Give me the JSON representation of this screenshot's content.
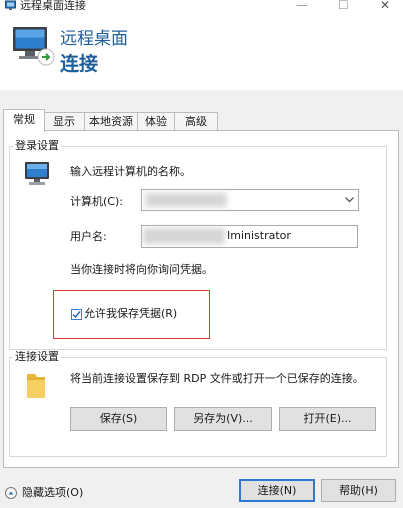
{
  "window": {
    "title": "远程桌面连接",
    "controls": [
      "—",
      "☐",
      "✕"
    ]
  },
  "banner": {
    "line1": "远程桌面",
    "line2": "连接"
  },
  "tabs": [
    {
      "label": "常规",
      "active": true
    },
    {
      "label": "显示",
      "active": false
    },
    {
      "label": "本地资源",
      "active": false
    },
    {
      "label": "体验",
      "active": false
    },
    {
      "label": "高级",
      "active": false
    }
  ],
  "login": {
    "group_title": "登录设置",
    "prompt": "输入远程计算机的名称。",
    "computer_label": "计算机(C):",
    "computer_value": "",
    "username_label": "用户名:",
    "username_value": "Iministrator",
    "hint": "当你连接时将向你询问凭据。",
    "allow_save_label": "允许我保存凭据(R)",
    "allow_save_checked": true
  },
  "connection": {
    "group_title": "连接设置",
    "description": "将当前连接设置保存到 RDP 文件或打开一个已保存的连接。",
    "save_button": "保存(S)",
    "save_as_button": "另存为(V)...",
    "open_button": "打开(E)..."
  },
  "footer": {
    "hide_options": "隐藏选项(O)",
    "connect_button": "连接(N)",
    "help_button": "帮助(H)"
  },
  "colors": {
    "accent": "#1f5e9c",
    "highlight_box": "#e23a3a",
    "primary_border": "#2e7ad1"
  }
}
